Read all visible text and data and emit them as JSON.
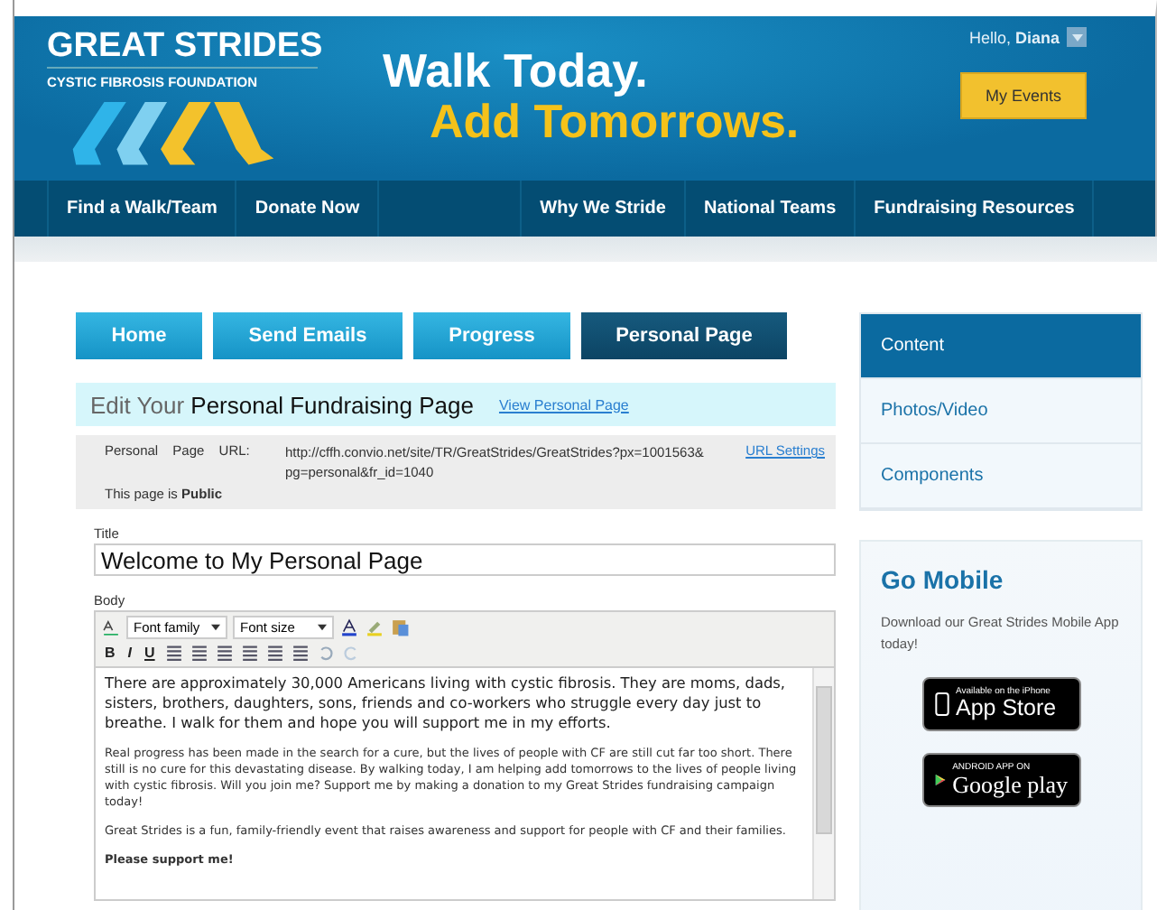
{
  "header": {
    "logo_title": "GREAT STRIDES",
    "logo_subtitle": "CYSTIC FIBROSIS FOUNDATION",
    "tagline_1": "Walk Today.",
    "tagline_2": "Add Tomorrows.",
    "greeting": "Hello,",
    "user": "Diana",
    "events_button": "My Events"
  },
  "nav": [
    {
      "label": "Find a Walk/Team",
      "kind": "item"
    },
    {
      "label": "Donate Now",
      "kind": "item"
    },
    {
      "kind": "spacer"
    },
    {
      "label": "Why We Stride",
      "kind": "item"
    },
    {
      "label": "National Teams",
      "kind": "item"
    },
    {
      "label": "Fundraising Resources",
      "kind": "item"
    }
  ],
  "tabs": [
    {
      "label": "Home",
      "selected": false
    },
    {
      "label": "Send Emails",
      "selected": false
    },
    {
      "label": "Progress",
      "selected": false
    },
    {
      "label": "Personal Page",
      "selected": true
    }
  ],
  "edit_heading": {
    "prefix": "Edit Your",
    "title": "Personal Fundraising Page",
    "link": "View Personal Page"
  },
  "url_box": {
    "label": "Personal Page URL:",
    "url": "http://cffh.convio.net/site/TR/GreatStrides/GreatStrides?px=1001563&pg=personal&fr_id=1040",
    "settings_link": "URL Settings",
    "status_label": "This page is",
    "status": "Public"
  },
  "title_field": {
    "label": "Title",
    "value": "Welcome to My Personal Page"
  },
  "body_field": {
    "label": "Body",
    "font_family": "Font family",
    "font_size": "Font size",
    "format_buttons": [
      "B",
      "I",
      "U"
    ],
    "paragraphs": [
      {
        "kind": "lead",
        "text": "There are approximately 30,000 Americans living with cystic fibrosis. They are moms, dads, sisters, brothers, daughters, sons, friends and co-workers who struggle every day just to breathe. I walk for them and hope you will support me in my efforts."
      },
      {
        "kind": "normal",
        "text": "Real progress has been made in the search for a cure, but the lives of people with CF are still cut far too short. There still is no cure for this devastating disease. By walking today, I am helping add tomorrows to the lives of people living with cystic fibrosis. Will you join me? Support me by making a donation to my Great Strides fundraising campaign today!"
      },
      {
        "kind": "normal",
        "text": "Great Strides is a fun, family-friendly event that raises awareness and support for people with CF and their families."
      },
      {
        "kind": "bold",
        "text": "Please support me!"
      }
    ]
  },
  "sidebar": {
    "items": [
      {
        "label": "Content",
        "selected": true
      },
      {
        "label": "Photos/Video",
        "selected": false
      },
      {
        "label": "Components",
        "selected": false
      }
    ]
  },
  "mobile": {
    "title": "Go Mobile",
    "text": "Download our Great Strides Mobile App today!",
    "app_store_small": "Available on the iPhone",
    "app_store": "App Store",
    "google_small": "ANDROID APP ON",
    "google": "Google play"
  }
}
